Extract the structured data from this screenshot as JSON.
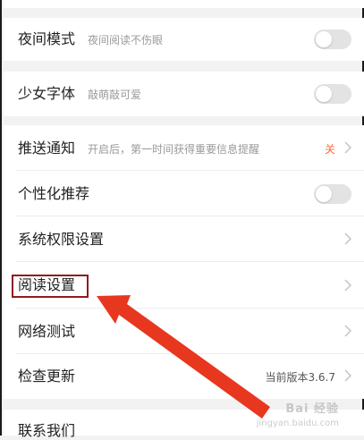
{
  "settings": {
    "night_mode": {
      "label": "夜间模式",
      "sub": "夜间阅读不伤眼"
    },
    "girl_font": {
      "label": "少女字体",
      "sub": "敲萌敲可爱"
    },
    "push": {
      "label": "推送通知",
      "sub": "开启后，第一时间获得重要信息提醒",
      "value": "关"
    },
    "personalized": {
      "label": "个性化推荐"
    },
    "permissions": {
      "label": "系统权限设置"
    },
    "reading": {
      "label": "阅读设置"
    },
    "network": {
      "label": "网络测试"
    },
    "update": {
      "label": "检查更新",
      "value": "当前版本3.6.7"
    },
    "contact": {
      "label": "联系我们"
    }
  },
  "toggles": {
    "night_mode": false,
    "girl_font": false,
    "personalized": false
  },
  "colors": {
    "accent_off_text": "#ff6a3d",
    "highlight_box": "#8e1b1b",
    "arrow": "#e8371f"
  },
  "watermark": {
    "brand": "Bai 经验",
    "url": "jingyan.baidu.com"
  }
}
